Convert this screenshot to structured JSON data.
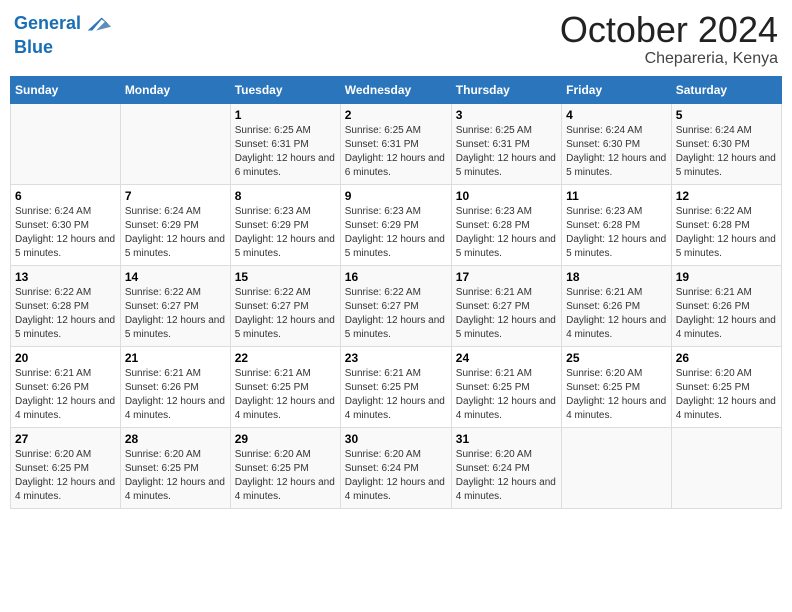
{
  "header": {
    "logo_line1": "General",
    "logo_line2": "Blue",
    "month": "October 2024",
    "location": "Chepareria, Kenya"
  },
  "weekdays": [
    "Sunday",
    "Monday",
    "Tuesday",
    "Wednesday",
    "Thursday",
    "Friday",
    "Saturday"
  ],
  "weeks": [
    [
      {
        "day": "",
        "sunrise": "",
        "sunset": "",
        "daylight": ""
      },
      {
        "day": "",
        "sunrise": "",
        "sunset": "",
        "daylight": ""
      },
      {
        "day": "1",
        "sunrise": "Sunrise: 6:25 AM",
        "sunset": "Sunset: 6:31 PM",
        "daylight": "Daylight: 12 hours and 6 minutes."
      },
      {
        "day": "2",
        "sunrise": "Sunrise: 6:25 AM",
        "sunset": "Sunset: 6:31 PM",
        "daylight": "Daylight: 12 hours and 6 minutes."
      },
      {
        "day": "3",
        "sunrise": "Sunrise: 6:25 AM",
        "sunset": "Sunset: 6:31 PM",
        "daylight": "Daylight: 12 hours and 5 minutes."
      },
      {
        "day": "4",
        "sunrise": "Sunrise: 6:24 AM",
        "sunset": "Sunset: 6:30 PM",
        "daylight": "Daylight: 12 hours and 5 minutes."
      },
      {
        "day": "5",
        "sunrise": "Sunrise: 6:24 AM",
        "sunset": "Sunset: 6:30 PM",
        "daylight": "Daylight: 12 hours and 5 minutes."
      }
    ],
    [
      {
        "day": "6",
        "sunrise": "Sunrise: 6:24 AM",
        "sunset": "Sunset: 6:30 PM",
        "daylight": "Daylight: 12 hours and 5 minutes."
      },
      {
        "day": "7",
        "sunrise": "Sunrise: 6:24 AM",
        "sunset": "Sunset: 6:29 PM",
        "daylight": "Daylight: 12 hours and 5 minutes."
      },
      {
        "day": "8",
        "sunrise": "Sunrise: 6:23 AM",
        "sunset": "Sunset: 6:29 PM",
        "daylight": "Daylight: 12 hours and 5 minutes."
      },
      {
        "day": "9",
        "sunrise": "Sunrise: 6:23 AM",
        "sunset": "Sunset: 6:29 PM",
        "daylight": "Daylight: 12 hours and 5 minutes."
      },
      {
        "day": "10",
        "sunrise": "Sunrise: 6:23 AM",
        "sunset": "Sunset: 6:28 PM",
        "daylight": "Daylight: 12 hours and 5 minutes."
      },
      {
        "day": "11",
        "sunrise": "Sunrise: 6:23 AM",
        "sunset": "Sunset: 6:28 PM",
        "daylight": "Daylight: 12 hours and 5 minutes."
      },
      {
        "day": "12",
        "sunrise": "Sunrise: 6:22 AM",
        "sunset": "Sunset: 6:28 PM",
        "daylight": "Daylight: 12 hours and 5 minutes."
      }
    ],
    [
      {
        "day": "13",
        "sunrise": "Sunrise: 6:22 AM",
        "sunset": "Sunset: 6:28 PM",
        "daylight": "Daylight: 12 hours and 5 minutes."
      },
      {
        "day": "14",
        "sunrise": "Sunrise: 6:22 AM",
        "sunset": "Sunset: 6:27 PM",
        "daylight": "Daylight: 12 hours and 5 minutes."
      },
      {
        "day": "15",
        "sunrise": "Sunrise: 6:22 AM",
        "sunset": "Sunset: 6:27 PM",
        "daylight": "Daylight: 12 hours and 5 minutes."
      },
      {
        "day": "16",
        "sunrise": "Sunrise: 6:22 AM",
        "sunset": "Sunset: 6:27 PM",
        "daylight": "Daylight: 12 hours and 5 minutes."
      },
      {
        "day": "17",
        "sunrise": "Sunrise: 6:21 AM",
        "sunset": "Sunset: 6:27 PM",
        "daylight": "Daylight: 12 hours and 5 minutes."
      },
      {
        "day": "18",
        "sunrise": "Sunrise: 6:21 AM",
        "sunset": "Sunset: 6:26 PM",
        "daylight": "Daylight: 12 hours and 4 minutes."
      },
      {
        "day": "19",
        "sunrise": "Sunrise: 6:21 AM",
        "sunset": "Sunset: 6:26 PM",
        "daylight": "Daylight: 12 hours and 4 minutes."
      }
    ],
    [
      {
        "day": "20",
        "sunrise": "Sunrise: 6:21 AM",
        "sunset": "Sunset: 6:26 PM",
        "daylight": "Daylight: 12 hours and 4 minutes."
      },
      {
        "day": "21",
        "sunrise": "Sunrise: 6:21 AM",
        "sunset": "Sunset: 6:26 PM",
        "daylight": "Daylight: 12 hours and 4 minutes."
      },
      {
        "day": "22",
        "sunrise": "Sunrise: 6:21 AM",
        "sunset": "Sunset: 6:25 PM",
        "daylight": "Daylight: 12 hours and 4 minutes."
      },
      {
        "day": "23",
        "sunrise": "Sunrise: 6:21 AM",
        "sunset": "Sunset: 6:25 PM",
        "daylight": "Daylight: 12 hours and 4 minutes."
      },
      {
        "day": "24",
        "sunrise": "Sunrise: 6:21 AM",
        "sunset": "Sunset: 6:25 PM",
        "daylight": "Daylight: 12 hours and 4 minutes."
      },
      {
        "day": "25",
        "sunrise": "Sunrise: 6:20 AM",
        "sunset": "Sunset: 6:25 PM",
        "daylight": "Daylight: 12 hours and 4 minutes."
      },
      {
        "day": "26",
        "sunrise": "Sunrise: 6:20 AM",
        "sunset": "Sunset: 6:25 PM",
        "daylight": "Daylight: 12 hours and 4 minutes."
      }
    ],
    [
      {
        "day": "27",
        "sunrise": "Sunrise: 6:20 AM",
        "sunset": "Sunset: 6:25 PM",
        "daylight": "Daylight: 12 hours and 4 minutes."
      },
      {
        "day": "28",
        "sunrise": "Sunrise: 6:20 AM",
        "sunset": "Sunset: 6:25 PM",
        "daylight": "Daylight: 12 hours and 4 minutes."
      },
      {
        "day": "29",
        "sunrise": "Sunrise: 6:20 AM",
        "sunset": "Sunset: 6:25 PM",
        "daylight": "Daylight: 12 hours and 4 minutes."
      },
      {
        "day": "30",
        "sunrise": "Sunrise: 6:20 AM",
        "sunset": "Sunset: 6:24 PM",
        "daylight": "Daylight: 12 hours and 4 minutes."
      },
      {
        "day": "31",
        "sunrise": "Sunrise: 6:20 AM",
        "sunset": "Sunset: 6:24 PM",
        "daylight": "Daylight: 12 hours and 4 minutes."
      },
      {
        "day": "",
        "sunrise": "",
        "sunset": "",
        "daylight": ""
      },
      {
        "day": "",
        "sunrise": "",
        "sunset": "",
        "daylight": ""
      }
    ]
  ]
}
